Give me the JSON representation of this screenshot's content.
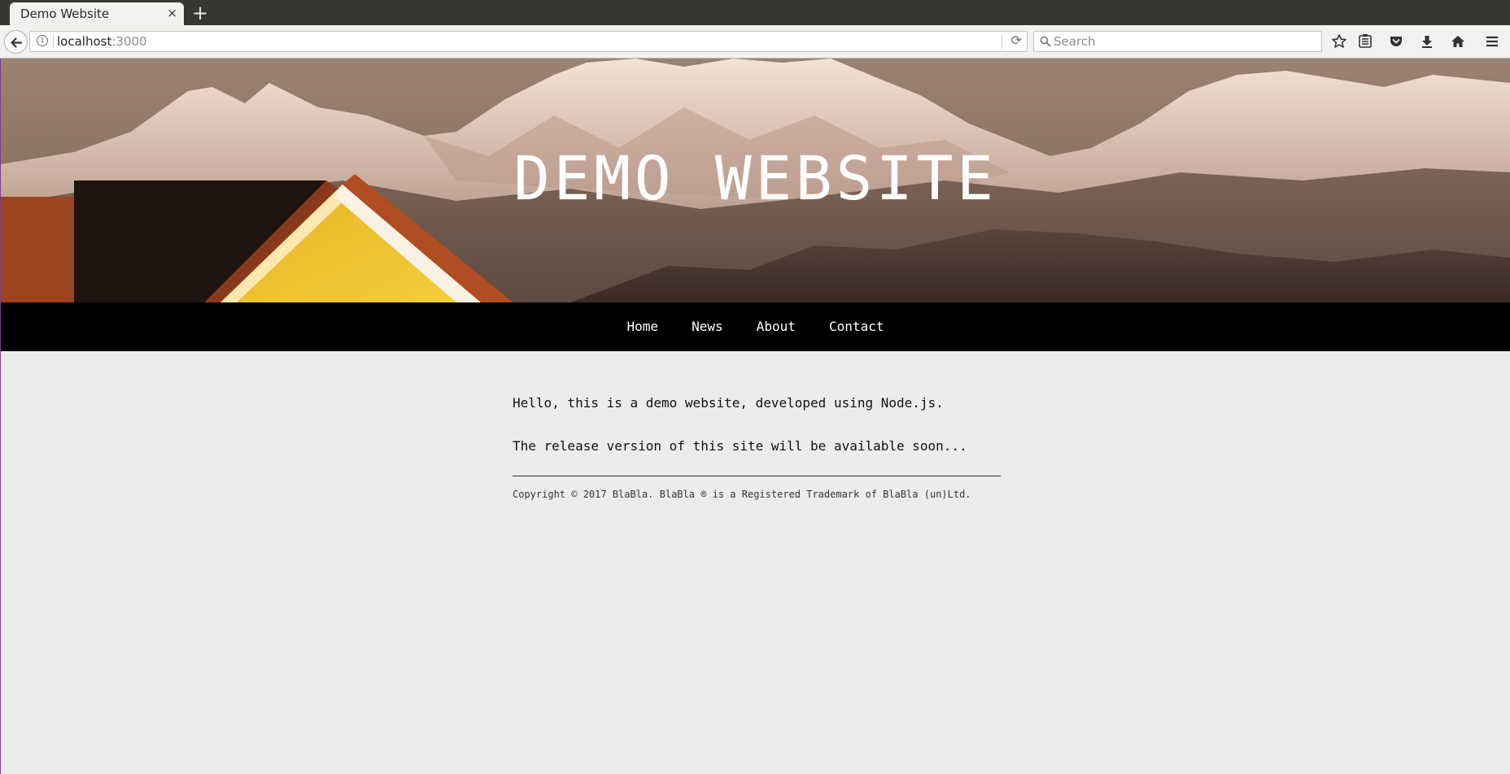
{
  "browser": {
    "tab_title": "Demo Website",
    "tab_close": "×",
    "new_tab": "+",
    "url_host": "localhost",
    "url_port": ":3000",
    "search_placeholder": "Search"
  },
  "hero": {
    "title": "DEMO WEBSITE"
  },
  "nav": {
    "items": [
      {
        "label": "Home"
      },
      {
        "label": "News"
      },
      {
        "label": "About"
      },
      {
        "label": "Contact"
      }
    ]
  },
  "content": {
    "paragraphs": [
      "Hello, this is a demo website, developed using Node.js.",
      "The release version of this site will be available soon..."
    ],
    "footer": "Copyright © 2017 BlaBla. BlaBla ® is a Registered Trademark of BlaBla (un)Ltd."
  }
}
